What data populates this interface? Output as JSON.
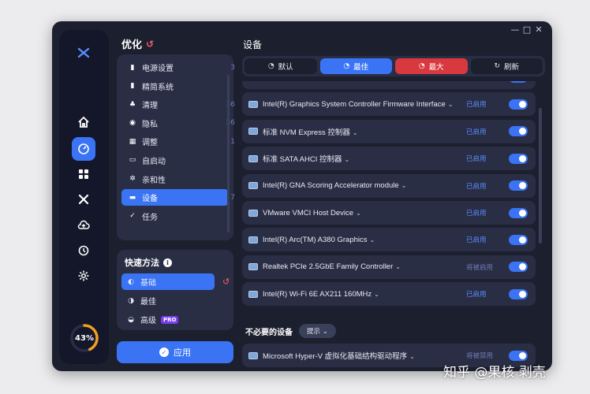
{
  "window": {
    "controls": [
      "—",
      "□",
      "✕"
    ]
  },
  "rail": {
    "items": [
      {
        "icon": "home-icon"
      },
      {
        "icon": "speedometer-icon",
        "active": true
      },
      {
        "icon": "apps-icon"
      },
      {
        "icon": "tools-icon"
      },
      {
        "icon": "cloud-upload-icon"
      },
      {
        "icon": "history-icon"
      },
      {
        "icon": "gear-icon"
      }
    ],
    "score": "43%",
    "score_fraction": 0.43,
    "accent": "#3a74f5",
    "gauge_color": "#f0a020"
  },
  "optimize": {
    "title": "优化",
    "categories": [
      {
        "label": "电源设置",
        "count": "3",
        "glyph": "▮"
      },
      {
        "label": "精简系统",
        "count": "",
        "glyph": "▮"
      },
      {
        "label": "清理",
        "count": "36",
        "glyph": "♣"
      },
      {
        "label": "隐私",
        "count": "36",
        "glyph": "◉"
      },
      {
        "label": "调整",
        "count": "1",
        "glyph": "▦"
      },
      {
        "label": "自启动",
        "count": "",
        "glyph": "▭"
      },
      {
        "label": "亲和性",
        "count": "",
        "glyph": "✲"
      },
      {
        "label": "设备",
        "count": "7",
        "glyph": "▬",
        "active": true
      },
      {
        "label": "任务",
        "count": "",
        "glyph": "✓"
      }
    ]
  },
  "quick": {
    "title": "快速方法",
    "items": [
      {
        "label": "基础",
        "glyph": "◐",
        "active": true
      },
      {
        "label": "最佳",
        "glyph": "◑"
      },
      {
        "label": "高级",
        "glyph": "◒",
        "badge": "PRO"
      }
    ]
  },
  "apply_label": "应用",
  "devices": {
    "title": "设备",
    "tabs": [
      {
        "label": "默认",
        "glyph": "◔"
      },
      {
        "label": "最佳",
        "glyph": "◔"
      },
      {
        "label": "最大",
        "glyph": "◔"
      },
      {
        "label": "刷新",
        "glyph": "↻"
      }
    ],
    "rows": [
      {
        "name": "Intel(R) Management Engine Interface #1",
        "status": "已启用"
      },
      {
        "name": "Intel(R) Graphics System Controller Firmware Interface",
        "status": "已启用"
      },
      {
        "name": "标准 NVM Express 控制器",
        "status": "已启用"
      },
      {
        "name": "标准 SATA AHCI 控制器",
        "status": "已启用"
      },
      {
        "name": "Intel(R) GNA Scoring Accelerator module",
        "status": "已启用"
      },
      {
        "name": "VMware VMCI Host Device",
        "status": "已启用"
      },
      {
        "name": "Intel(R) Arc(TM) A380 Graphics",
        "status": "已启用"
      },
      {
        "name": "Realtek PCIe 2.5GbE Family Controller",
        "status": "将被启用"
      },
      {
        "name": "Intel(R) Wi-Fi 6E AX211 160MHz",
        "status": "已启用"
      }
    ],
    "unneeded_title": "不必要的设备",
    "hint_label": "提示",
    "unneeded_rows": [
      {
        "name": "Microsoft Hyper-V 虚拟化基础结构驱动程序",
        "status": "将被禁用"
      }
    ]
  },
  "watermark": "知乎 @果核 剥壳"
}
